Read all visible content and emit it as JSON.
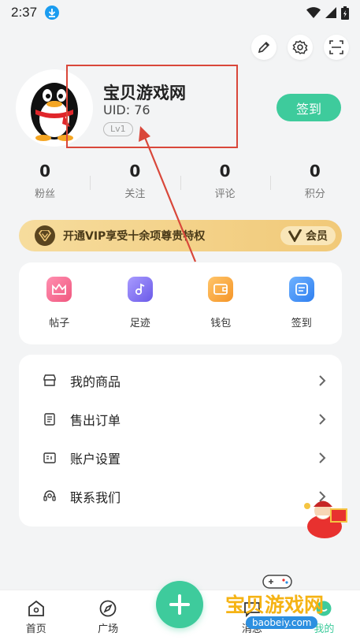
{
  "status_bar": {
    "time": "2:37"
  },
  "profile": {
    "username": "宝贝游戏网",
    "uid": "UID: 76",
    "level": "Lv1",
    "checkin_label": "签到"
  },
  "stats": [
    {
      "value": "0",
      "label": "粉丝"
    },
    {
      "value": "0",
      "label": "关注"
    },
    {
      "value": "0",
      "label": "评论"
    },
    {
      "value": "0",
      "label": "积分"
    }
  ],
  "vip": {
    "text": "开通VIP享受十余项尊贵特权",
    "badge": "会员"
  },
  "quick_actions": [
    {
      "label": "帖子",
      "icon": "crown-icon",
      "color": "#f16a8f"
    },
    {
      "label": "足迹",
      "icon": "music-note-icon",
      "color": "#7b6cf0"
    },
    {
      "label": "钱包",
      "icon": "wallet-icon",
      "color": "#f7a23b"
    },
    {
      "label": "签到",
      "icon": "calendar-icon",
      "color": "#3e8ef7"
    }
  ],
  "menu": [
    {
      "label": "我的商品",
      "icon": "shop-icon"
    },
    {
      "label": "售出订单",
      "icon": "order-icon"
    },
    {
      "label": "账户设置",
      "icon": "account-card-icon"
    },
    {
      "label": "联系我们",
      "icon": "headset-icon"
    }
  ],
  "tabbar": [
    {
      "label": "首页",
      "icon": "home-icon"
    },
    {
      "label": "广场",
      "icon": "compass-icon"
    },
    {
      "label": "消息",
      "icon": "message-icon"
    },
    {
      "label": "我的",
      "icon": "profile-icon"
    }
  ],
  "watermark": {
    "title": "宝贝游戏网",
    "url": "baobeiy.com"
  },
  "colors": {
    "accent": "#3ecb9c",
    "annotation": "#d9473a",
    "vip_gold": "#f1c978"
  }
}
